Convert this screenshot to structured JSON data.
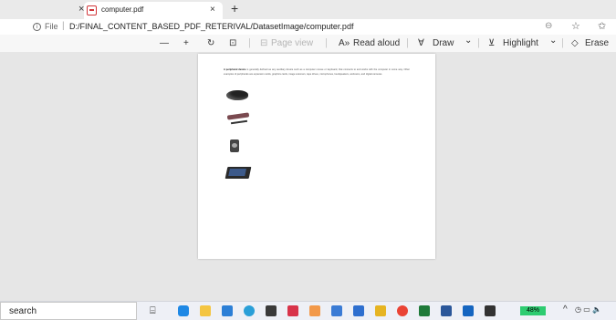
{
  "tabs": [
    {
      "title": "computer.pdf",
      "close": "×"
    }
  ],
  "tabstrip": {
    "left_close": "×",
    "new_tab": "+"
  },
  "address": {
    "info_glyph": "i",
    "label": "File",
    "separator": "|",
    "url": "D:/FINAL_CONTENT_BASED_PDF_RETERIVAL/DatasetImage/computer.pdf"
  },
  "pdf_toolbar": {
    "zoom_out": "—",
    "zoom_in": "+",
    "rotate": "↻",
    "fit": "⊡",
    "sep": "|",
    "page_view": "Page view",
    "read_aloud": "Read aloud",
    "draw": "Draw",
    "highlight": "Highlight",
    "erase": "Erase",
    "chevron": "⌄"
  },
  "document": {
    "paragraph_lead": "A peripheral device",
    "paragraph_body": " is generally defined as any auxiliary device such as a computer mouse or keyboard, that connects to and works with the computer in some way. Other examples of peripherals are expansion cards, graphics cards, image scanners, tape drives, microphones, loudspeakers, webcams, and digital cameras."
  },
  "taskbar": {
    "search": "search",
    "task_view": "⌸",
    "battery": "48%",
    "tray_chevron": "^",
    "tray_extra": "◷ ▭ 🔈"
  },
  "colors": {
    "tab_strip": "#eaeaea",
    "viewport": "#e6e6e6",
    "taskbar": "#eef0f6",
    "pdf_red": "#d13438"
  }
}
